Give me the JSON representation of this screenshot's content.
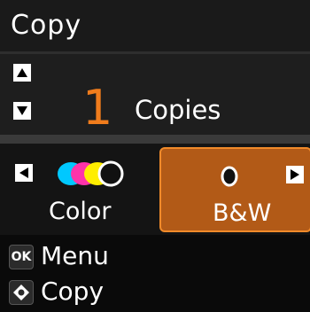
{
  "header": {
    "title": "Copy"
  },
  "copies": {
    "count": "1",
    "label": "Copies"
  },
  "modes": {
    "color_label": "Color",
    "bw_label": "B&W",
    "selected": "B&W"
  },
  "hints": [
    {
      "key_label": "OK",
      "label": "Menu"
    },
    {
      "key_label": "◆",
      "label": "Copy"
    }
  ],
  "colors": {
    "accent": "#f07c1c",
    "selected_bg": "#b25a17",
    "selected_border": "#f08a2a",
    "ink_cyan": "#00c8ff",
    "ink_magenta": "#ff33aa",
    "ink_yellow": "#ffee00",
    "ink_black": "#111111"
  }
}
